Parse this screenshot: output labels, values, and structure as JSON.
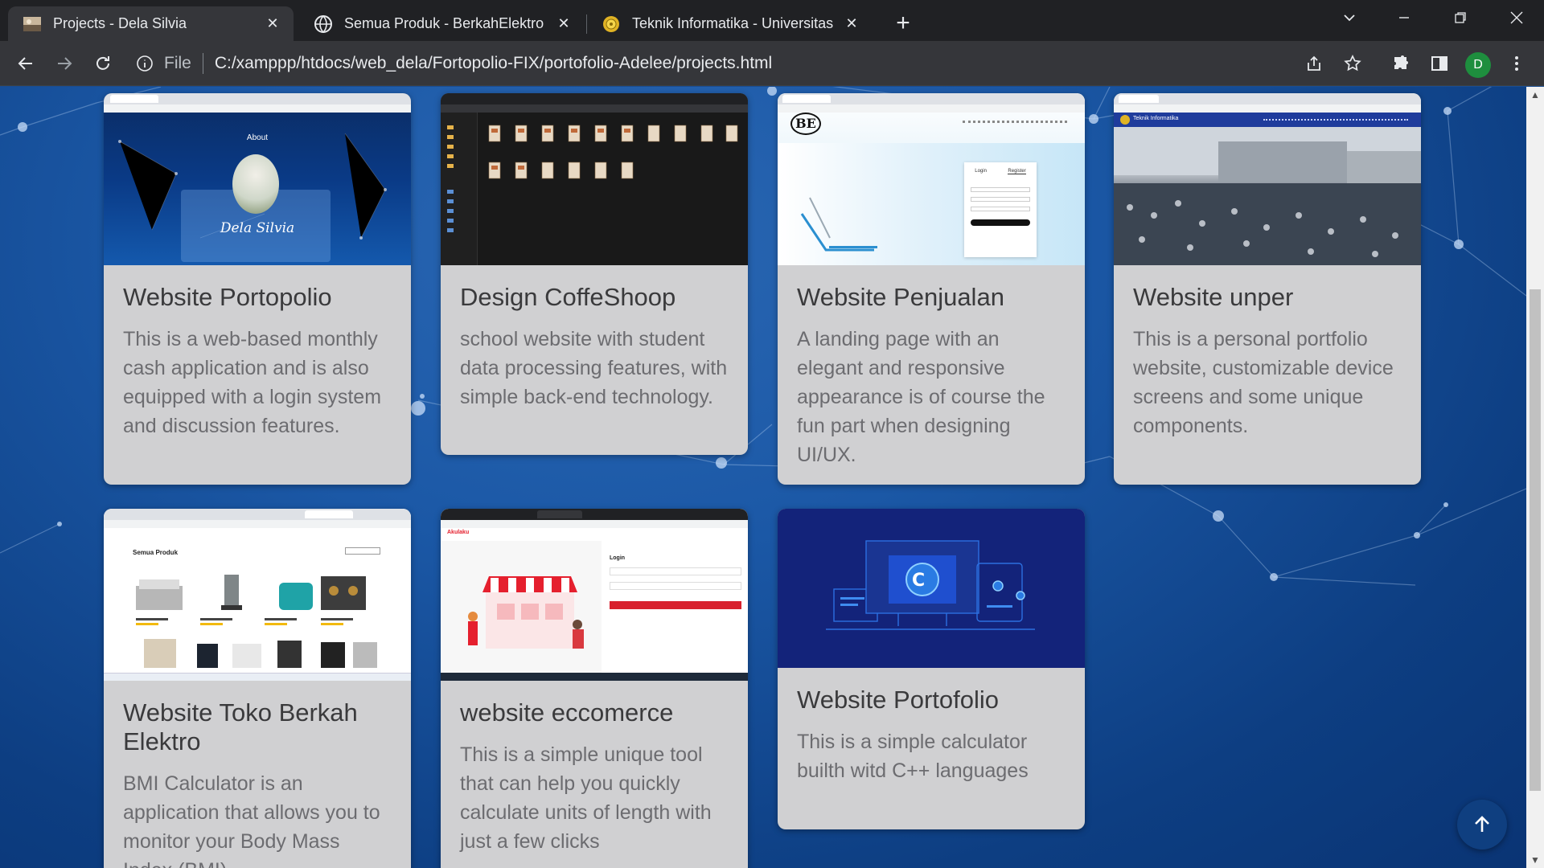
{
  "tabs": [
    {
      "title": "Projects - Dela Silvia",
      "favicon": "photo-favicon",
      "active": true
    },
    {
      "title": "Semua Produk - BerkahElektro | E",
      "favicon": "globe-icon",
      "active": false
    },
    {
      "title": "Teknik Informatika - Universitas P",
      "favicon": "university-seal-icon",
      "active": false
    }
  ],
  "toolbar": {
    "file_label": "File",
    "url": "C:/xamppp/htdocs/web_dela/Fortopolio-FIX/portofolio-Adelee/projects.html",
    "profile_initial": "D"
  },
  "projects": [
    {
      "title": "Website Portopolio",
      "description": "This is a web-based monthly cash application and is also equipped with a login system and discussion features."
    },
    {
      "title": "Design CoffeShoop",
      "description": "school website with student data processing features, with simple back-end technology."
    },
    {
      "title": "Website Penjualan",
      "description": "A landing page with an elegant and responsive appearance is of course the fun part when designing UI/UX."
    },
    {
      "title": "Website unper",
      "description": "This is a personal portfolio website, customizable device screens and some unique components."
    },
    {
      "title": "Website Toko Berkah Elektro",
      "description": "BMI Calculator is an application that allows you to monitor your Body Mass Index (BMI)"
    },
    {
      "title": "website eccomerce",
      "description": "This is a simple unique tool that can help you quickly calculate units of length with just a few clicks"
    },
    {
      "title": "Website Portofolio",
      "description": "This is a simple calculator builth witd C++ languages"
    }
  ],
  "thumbnails": {
    "portfolio": {
      "about": "About",
      "name": "Dela Silvia"
    },
    "penjualan": {
      "logo": "BE",
      "login": "Login",
      "register": "Register"
    },
    "unper": {
      "brand": "Teknik Informatika"
    },
    "toko": {
      "heading": "Semua Produk"
    },
    "ecommerce": {
      "brand": "Akulaku",
      "login": "Login"
    }
  },
  "colors": {
    "background": "#1a4c90",
    "card": "#d0d0d2",
    "title": "#3a3a3c",
    "description": "#6c6c70"
  }
}
